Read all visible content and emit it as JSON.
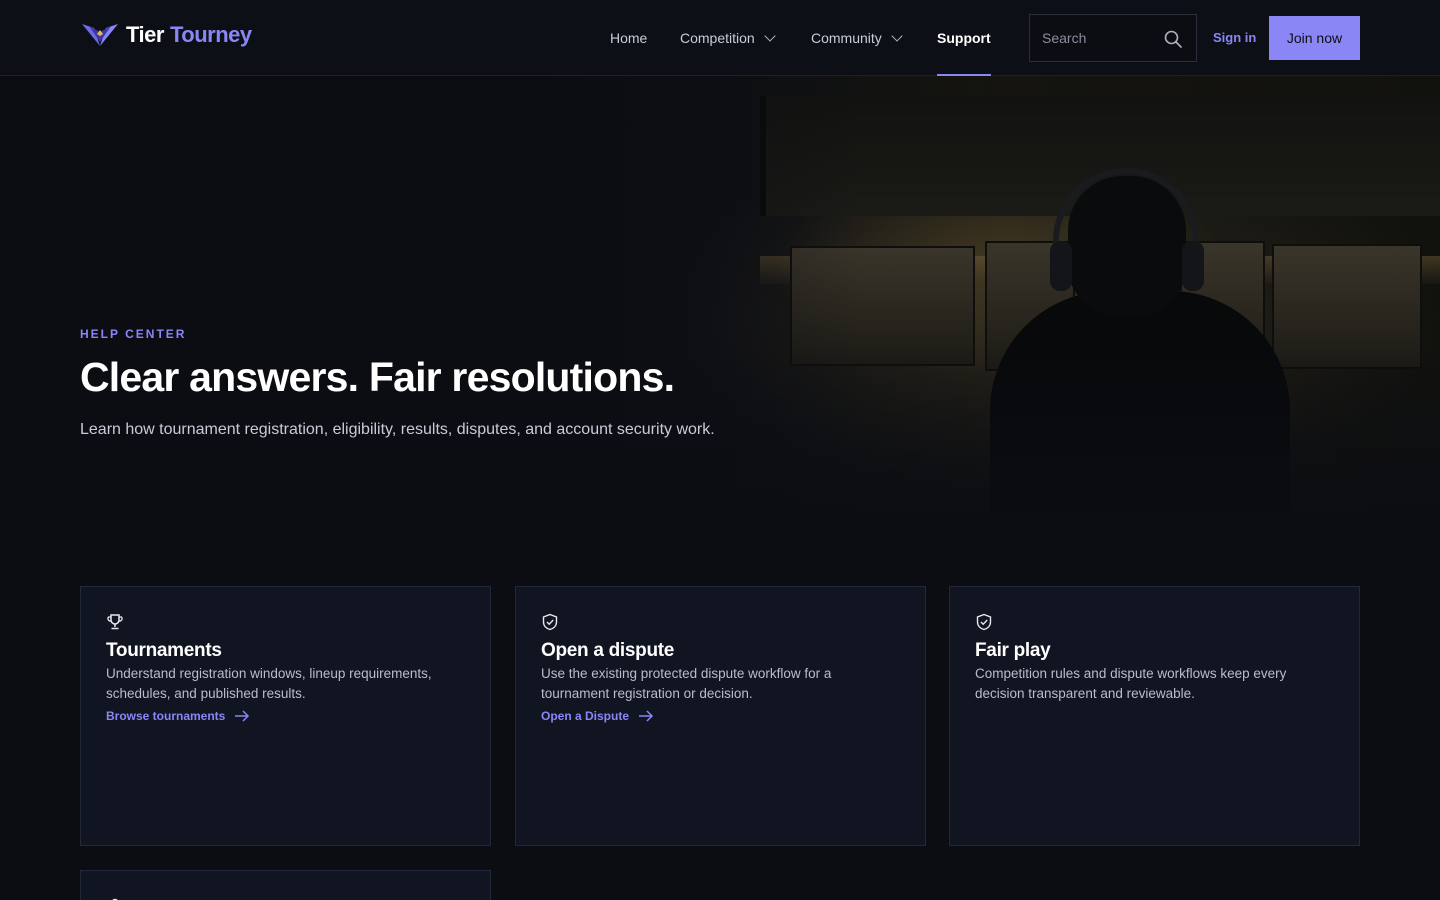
{
  "brand": {
    "name_part1": "Tier",
    "name_part2": "Tourney",
    "accent_color": "#8b86f5"
  },
  "nav": {
    "items": [
      {
        "label": "Home",
        "has_dropdown": false,
        "active": false
      },
      {
        "label": "Competition",
        "has_dropdown": true,
        "active": false
      },
      {
        "label": "Community",
        "has_dropdown": true,
        "active": false
      },
      {
        "label": "Support",
        "has_dropdown": false,
        "active": true
      }
    ]
  },
  "search": {
    "placeholder": "Search",
    "icon": "search-icon"
  },
  "auth": {
    "signin_label": "Sign in",
    "join_label": "Join now"
  },
  "hero": {
    "eyebrow": "HELP CENTER",
    "title": "Clear answers. Fair resolutions.",
    "subtitle": "Learn how tournament registration, eligibility, results, disputes, and account security work."
  },
  "cards": [
    {
      "icon": "trophy-icon",
      "title": "Tournaments",
      "description": "Understand registration windows, lineup requirements, schedules, and published results.",
      "link_label": "Browse tournaments"
    },
    {
      "icon": "shield-check-icon",
      "title": "Open a dispute",
      "description": "Use the existing protected dispute workflow for a tournament registration or decision.",
      "link_label": "Open a Dispute"
    },
    {
      "icon": "shield-check-icon",
      "title": "Fair play",
      "description": "Competition rules and dispute workflows keep every decision transparent and reviewable.",
      "link_label": ""
    }
  ]
}
